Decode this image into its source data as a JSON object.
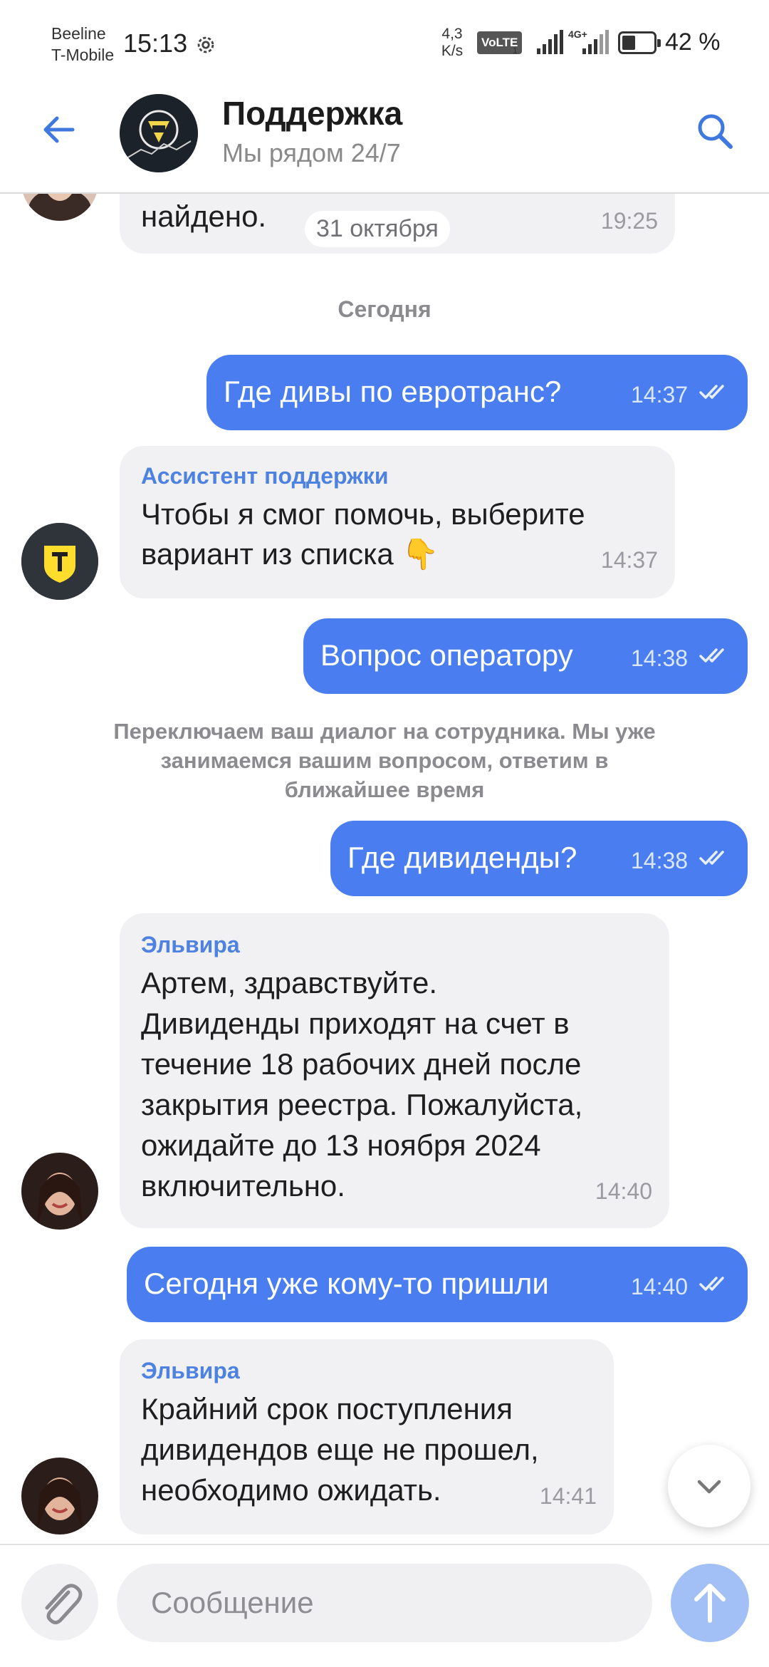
{
  "status_bar": {
    "carrier_1": "Beeline",
    "carrier_2": "T-Mobile",
    "time": "15:13",
    "net_speed_value": "4,3",
    "net_speed_unit": "K/s",
    "volte": "VoLTE",
    "volte_sim": "1",
    "network_type": "4G+",
    "battery_level": 0.42,
    "battery_text": "42 %"
  },
  "header": {
    "title": "Поддержка",
    "subtitle": "Мы рядом 24/7",
    "back_icon": "arrow-left-icon",
    "search_icon": "search-icon"
  },
  "chat": {
    "prev_message": {
      "text": "найдено.",
      "time": "19:25"
    },
    "date_chip": "31 октября",
    "day_separator": "Сегодня",
    "msg_out_1": {
      "text": "Где дивы по евротранс?",
      "time": "14:37"
    },
    "msg_in_1": {
      "sender": "Ассистент поддержки",
      "line1": "Чтобы я смог помочь, выберите",
      "line2": "вариант из списка 👇",
      "time": "14:37"
    },
    "msg_out_2": {
      "text": "Вопрос оператору",
      "time": "14:38"
    },
    "system_notice": "Переключаем ваш диалог на сотрудника. Мы уже занимаемся вашим вопросом, ответим в ближайшее время",
    "msg_out_3": {
      "text": "Где дивиденды?",
      "time": "14:38"
    },
    "msg_in_2": {
      "sender": "Эльвира",
      "line1": "Артем, здравствуйте.",
      "line2": "Дивиденды приходят на счет в",
      "line3": "течение 18 рабочих дней после",
      "line4": "закрытия реестра. Пожалуйста,",
      "line5": "ожидайте до 13 ноября 2024",
      "line6": "включительно.",
      "time": "14:40"
    },
    "msg_out_4": {
      "text": "Сегодня уже кому-то пришли",
      "time": "14:40"
    },
    "msg_in_3": {
      "sender": "Эльвира",
      "line1": "Крайний срок поступления",
      "line2": "дивидендов еще не прошел,",
      "line3": "необходимо ожидать.",
      "time": "14:41"
    }
  },
  "composer": {
    "placeholder": "Сообщение",
    "attach_icon": "paperclip-icon",
    "send_icon": "arrow-up-icon"
  },
  "colors": {
    "accent": "#4a7ef0",
    "incoming_bubble": "#f1f1f4",
    "sender_name": "#4d82e0",
    "send_button": "#a3c0f6",
    "bot_badge": "#ffdd2d"
  }
}
